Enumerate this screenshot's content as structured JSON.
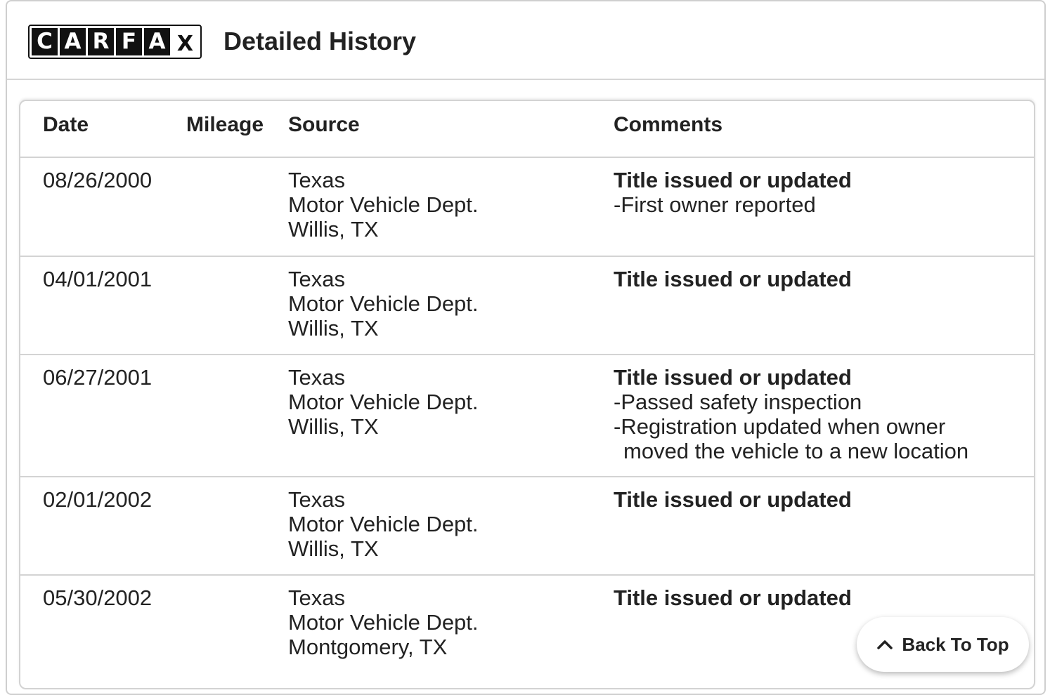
{
  "header": {
    "logo_letters": [
      "C",
      "A",
      "R",
      "F",
      "A",
      "X"
    ],
    "title": "Detailed History"
  },
  "table": {
    "columns": {
      "date": "Date",
      "mileage": "Mileage",
      "source": "Source",
      "comments": "Comments"
    },
    "rows": [
      {
        "date": "08/26/2000",
        "mileage": "",
        "source": [
          "Texas",
          "Motor Vehicle Dept.",
          "Willis, TX"
        ],
        "comment_title": "Title issued or updated",
        "comment_items": [
          "First owner reported"
        ]
      },
      {
        "date": "04/01/2001",
        "mileage": "",
        "source": [
          "Texas",
          "Motor Vehicle Dept.",
          "Willis, TX"
        ],
        "comment_title": "Title issued or updated",
        "comment_items": []
      },
      {
        "date": "06/27/2001",
        "mileage": "",
        "source": [
          "Texas",
          "Motor Vehicle Dept.",
          "Willis, TX"
        ],
        "comment_title": "Title issued or updated",
        "comment_items": [
          "Passed safety inspection",
          "Registration updated when owner moved the vehicle to a new location"
        ]
      },
      {
        "date": "02/01/2002",
        "mileage": "",
        "source": [
          "Texas",
          "Motor Vehicle Dept.",
          "Willis, TX"
        ],
        "comment_title": "Title issued or updated",
        "comment_items": []
      },
      {
        "date": "05/30/2002",
        "mileage": "",
        "source": [
          "Texas",
          "Motor Vehicle Dept.",
          "Montgomery, TX"
        ],
        "comment_title": "Title issued or updated",
        "comment_items": []
      }
    ]
  },
  "back_to_top": {
    "label": "Back To Top",
    "icon": "chevron-up-icon"
  }
}
